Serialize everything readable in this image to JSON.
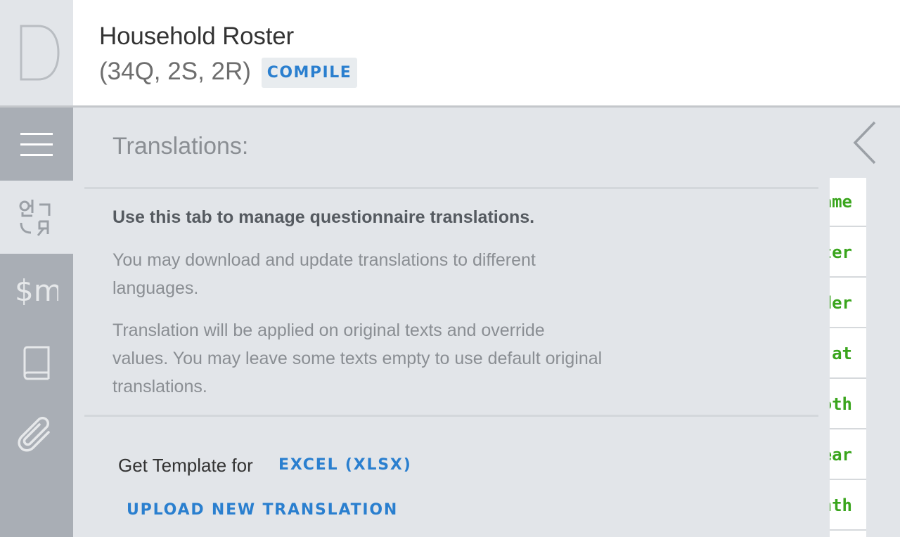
{
  "header": {
    "logo_letter_icon": "letter-d-logo-icon",
    "title": "Household Roster",
    "stats": "(34Q, 2S, 2R)",
    "compile_label": "COMPILE"
  },
  "rail": {
    "items": [
      {
        "icon": "hamburger-menu-icon",
        "active": false
      },
      {
        "icon": "translation-icon",
        "active": true
      },
      {
        "icon": "macros-icon",
        "active": false
      },
      {
        "icon": "book-icon",
        "active": false
      },
      {
        "icon": "paperclip-icon",
        "active": false
      }
    ]
  },
  "panel": {
    "title": "Translations:",
    "intro": "Use this tab to manage questionnaire translations.",
    "para1": "You may download and update translations to different languages.",
    "para2": "Translation will be applied on original texts and override values. You may leave some texts empty to use default original translations.",
    "template_label": "Get Template for",
    "excel_link": "EXCEL (XLSX)",
    "upload_link": "UPLOAD NEW TRANSLATION"
  },
  "right_strip": {
    "collapse_icon": "chevron-left-icon",
    "items": [
      "ame",
      "ter",
      "der",
      "at",
      "oth",
      "ear",
      "nth"
    ]
  },
  "colors": {
    "accent": "#2a7fcf",
    "variable_green": "#3aa51d",
    "rail_bg": "#a9aeb5",
    "panel_bg": "#e2e5e9"
  }
}
